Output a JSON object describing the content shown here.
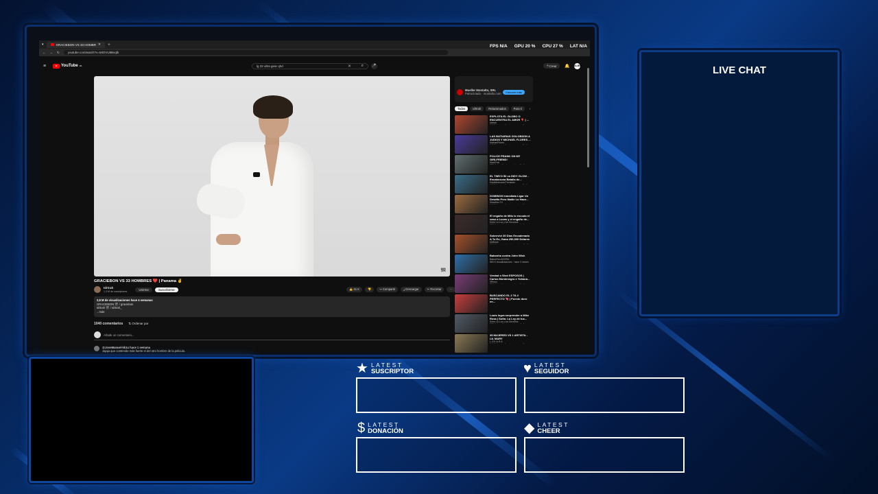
{
  "browser": {
    "tab_title": "GRACIEBON VS 33 HOMBR",
    "url": "youtube.com/watch?v=MIOVU9Bvqlk",
    "perf": [
      {
        "label": "FPS",
        "value": "N/A"
      },
      {
        "label": "GPU",
        "value": "20 %"
      },
      {
        "label": "CPU",
        "value": "27 %"
      },
      {
        "label": "LAT",
        "value": "N/A"
      }
    ]
  },
  "youtube": {
    "logo": "YouTube",
    "logo_region": "PA",
    "search_value": "lg 32 ultra gear qhd",
    "create_label": "Crear",
    "avatar": "ALIEN",
    "video_title": "GRACIEBON VS 33 HOMBRES ❤️ | Panama ✌️",
    "watermark": "𝕸",
    "channel": {
      "name": "Idrtrah",
      "subs": "1,3 M de suscriptores",
      "unirme": "Unirme",
      "subscribed": "Suscribirme"
    },
    "actions": [
      "👍 41 K",
      "👎",
      "↪ Compartir",
      "⤓ Descargar",
      "✂ Recortar",
      "⋯"
    ],
    "description": {
      "stats": "2,8 M de visualizaciones hace 4 semanas",
      "line1": "GRACIEBON 🎬 / graciebon",
      "line2": "Idrtrah 🎬 / Idrtrah_",
      "more": "...más"
    },
    "comments_count": "1040 comentarios",
    "sort_label": "Ordenar por",
    "add_comment_placeholder": "Añade un comentario...",
    "first_comment": {
      "author": "@JoseManuel-kk1u hace 1 semana",
      "text": "Jajaja que contenido más fuerte el del otro hombre de la pelicula."
    },
    "ad": {
      "name": "Mueller Montalto, SRL",
      "sponsored": "Patrocinado · montalto.com",
      "cta": "Conocer más"
    },
    "chips": [
      "Todos",
      "Idrtrah",
      "Relacionados",
      "Para ti"
    ],
    "recommendations": [
      {
        "title": "EXPLOTA EL GLOBO O ENCUENTRA EL AMOR 🎈 | ...",
        "channel": "Idrtrah",
        "meta": "3,5 M de visualizaciones · hace 3 meses",
        "color": "#b0462f"
      },
      {
        "title": "LAS BATIARIAS GOLOBSON A JUDIOS Y MICHAEL FLORES ...",
        "channel": "MichaelFlores",
        "meta": "1,7 M de visualizaciones · hace 3 años",
        "color": "#4a3b9c"
      },
      {
        "title": "POLICE PRANK ON MY GIRLFRIEND!",
        "channel": "MarkTrial",
        "meta": "883 K visualizaciones · hace 2 años",
        "color": "#5f6f70"
      },
      {
        "title": "EL TIMYO 50 vs DIDY GLOW - Encabezona Batalla de...",
        "channel": "HolaMexicana Premiado",
        "meta": "1,2 M de visualizaciones · hace 3 años",
        "color": "#3a6d88"
      },
      {
        "title": "DOMINOS Inmediata Ligar Un Desafío Pero Nadie Lo Hace...",
        "channel": "Desafíos 2.0",
        "meta": "1,5 M de visualizaciones · hace 7 meses",
        "color": "#9b6b3f"
      },
      {
        "title": "El engaño de Milo lo escuda el caso a Lucas y el engaño de...",
        "channel": "Entre La Luz y los Secretos",
        "meta": "982 K visualizaciones · hace 4 años",
        "color": "#3d2b2b"
      },
      {
        "title": "Sobreviví 30 Días Encadenado A Tu Ex, Gana 250,000 Dólares",
        "channel": "MrBeast",
        "meta": "124 M de visualizaciones · hace 2 años",
        "color": "#a5512b"
      },
      {
        "title": "Babosha contra John Wick",
        "channel": "BabosFan ADORA",
        "meta": "583 K visualizaciones · hace 3 meses",
        "color": "#2e6fa8"
      },
      {
        "title": "Verdad o Shot ESPOSOS | Carlos Montenegro e Yohana...",
        "channel": "3Perso",
        "meta": "712 K visualizaciones · hace 2 años",
        "color": "#7a3c78"
      },
      {
        "title": "BUSCANDO EL 2 TA 2 PERFECTO 💘 | Puesto duro en...",
        "channel": "Idrtrah",
        "meta": "11 M de visualizaciones · hace 1 mes",
        "color": "#c83d3d"
      },
      {
        "title": "Louis logra sorprender a Mike Rosa | Sofía: La Ley de tus...",
        "channel": "Entre La Luz y los Secretos",
        "meta": "962 K visualizaciones · hace 4 años",
        "color": "#515a66"
      },
      {
        "title": "35 MUJERES VS 1 ARTISTA - LIL MARY",
        "channel": "L.O.K.A.R.A",
        "meta": "1,1 M de visualizaciones · hace 3 meses",
        "color": "#8a7a55"
      }
    ]
  },
  "overlay": {
    "live_chat_title": "LIVE CHAT",
    "latest": [
      {
        "icon": "★",
        "small": "LATEST",
        "big": "SUSCRIPTOR"
      },
      {
        "icon": "♥",
        "small": "LATEST",
        "big": "SEGUIDOR"
      },
      {
        "icon": "$",
        "small": "LATEST",
        "big": "DONACIÓN"
      },
      {
        "icon": "◆",
        "small": "LATEST",
        "big": "CHEER"
      }
    ]
  }
}
